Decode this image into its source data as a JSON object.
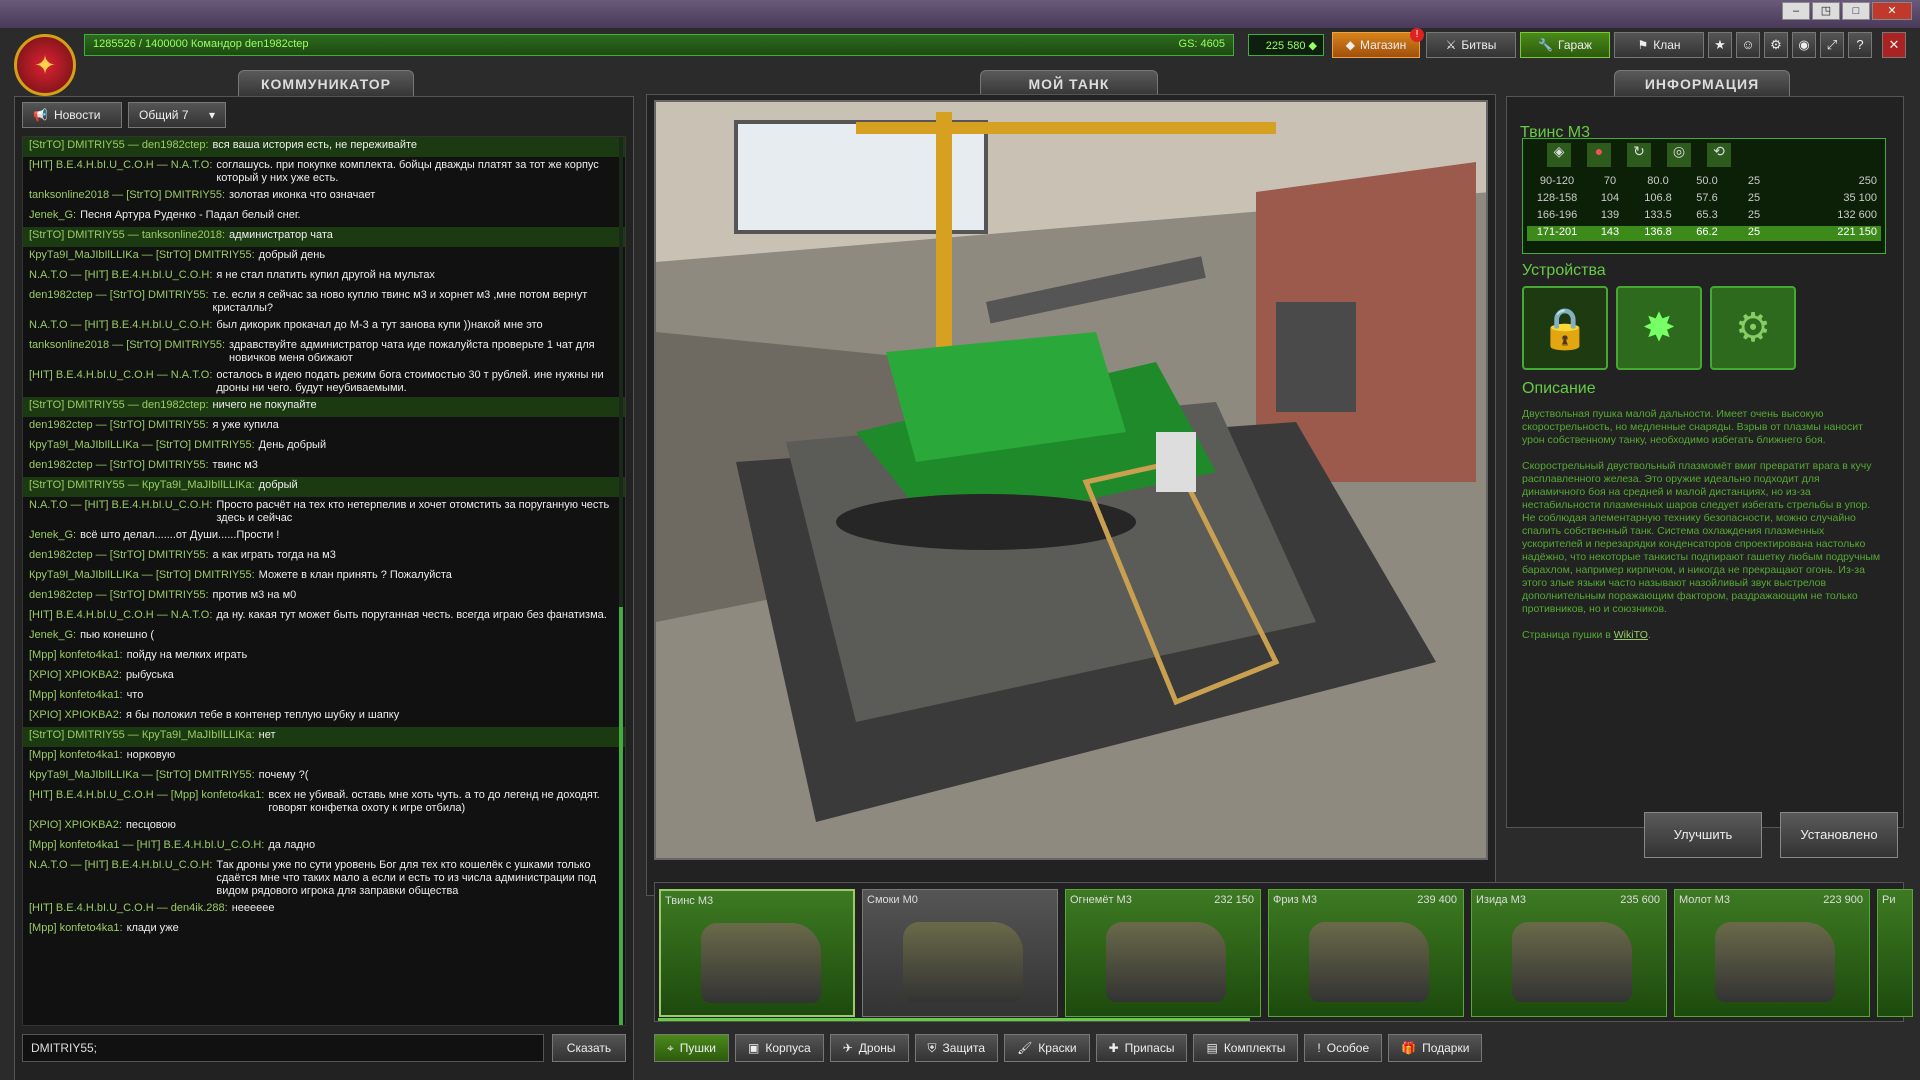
{
  "window": {
    "min": "–",
    "max": "□",
    "restore": "◳",
    "close": "✕"
  },
  "topbar": {
    "rank_progress": "1285526 / 1400000",
    "player": "Командор den1982ctep",
    "gs": "GS: 4605",
    "crystals": "225 580"
  },
  "nav": {
    "shop": "Магазин",
    "shop_badge": "!",
    "battles": "Битвы",
    "garage": "Гараж",
    "clan": "Клан"
  },
  "panels": {
    "comm": "КОММУНИКАТОР",
    "tank": "МОЙ ТАНК",
    "info": "ИНФОРМАЦИЯ"
  },
  "comm": {
    "news": "Новости",
    "channel": "Общий 7",
    "input_value": "DMITRIY55;",
    "say": "Сказать"
  },
  "chat": [
    {
      "who": "[StrTO] DMITRIY55 — den1982ctep:",
      "msg": "вся ваша история есть, не переживайте",
      "hl": true
    },
    {
      "who": "[HIT] В.Е.4.Н.bI.U_C.O.H — N.A.T.O:",
      "msg": "соглашусь. при покупке комплекта. бойцы дважды платят за тот же корпус который у них уже есть.",
      "hl": false
    },
    {
      "who": "tanksonline2018 — [StrTO] DMITRIY55:",
      "msg": "золотая иконка что означает",
      "hl": false
    },
    {
      "who": "Jenek_G:",
      "msg": "Песня Артура Руденко - Падал белый снег.",
      "hl": false
    },
    {
      "who": "[StrTO] DMITRIY55 — tanksonline2018:",
      "msg": "администратор чата",
      "hl": true
    },
    {
      "who": "КруТа9I_MaJIbIlLLIKa — [StrTO] DMITRIY55:",
      "msg": "добрый день",
      "hl": false
    },
    {
      "who": "N.A.T.O — [HIT] В.Е.4.Н.bI.U_C.O.H:",
      "msg": "я не стал платить купил другой на мультах",
      "hl": false
    },
    {
      "who": "den1982ctep — [StrTO] DMITRIY55:",
      "msg": "т.е. если я сейчас за ново куплю твинс м3 и хорнет м3 ,мне потом вернут кристаллы?",
      "hl": false
    },
    {
      "who": "N.A.T.O — [HIT] В.Е.4.Н.bI.U_C.O.H:",
      "msg": "был дикорик прокачал до М-3 а тут занова купи ))накой мне это",
      "hl": false
    },
    {
      "who": "tanksonline2018 — [StrTO] DMITRIY55:",
      "msg": "здравствуйте администратор чата иде пожалуйста проверьте 1 чат для новичков меня обижают",
      "hl": false
    },
    {
      "who": "[HIT] В.Е.4.Н.bI.U_C.O.H — N.A.T.O:",
      "msg": "осталось в идею подать режим бога стоимостью 30 т рублей. ине нужны ни дроны ни чего. будут неубиваемыми.",
      "hl": false
    },
    {
      "who": "[StrTO] DMITRIY55 — den1982ctep:",
      "msg": "ничего не покупайте",
      "hl": true
    },
    {
      "who": "den1982ctep — [StrTO] DMITRIY55:",
      "msg": "я уже купила",
      "hl": false
    },
    {
      "who": "КруТа9I_MaJIbIlLLIKa — [StrTO] DMITRIY55:",
      "msg": "День добрый",
      "hl": false
    },
    {
      "who": "den1982ctep — [StrTO] DMITRIY55:",
      "msg": "твинс м3",
      "hl": false
    },
    {
      "who": "[StrTO] DMITRIY55 — КруТа9I_MaJIbIlLLIKa:",
      "msg": "добрый",
      "hl": true
    },
    {
      "who": "N.A.T.O — [HIT] В.Е.4.Н.bI.U_C.O.H:",
      "msg": "Просто расчёт на тех кто нетерпелив и хочет отомстить за поруганную честь здесь и сейчас",
      "hl": false
    },
    {
      "who": "Jenek_G:",
      "msg": "всё што делал.......от Души......Прости !",
      "hl": false
    },
    {
      "who": "den1982ctep — [StrTO] DMITRIY55:",
      "msg": "а как играть тогда на м3",
      "hl": false
    },
    {
      "who": "КруТа9I_MaJIbIlLLIKa — [StrTO] DMITRIY55:",
      "msg": "Можете в клан принять ? Пожалуйста",
      "hl": false
    },
    {
      "who": "den1982ctep — [StrTO] DMITRIY55:",
      "msg": "против м3 на м0",
      "hl": false
    },
    {
      "who": "[HIT] В.Е.4.Н.bI.U_C.O.H — N.A.T.O:",
      "msg": "да ну. какая тут может быть поруганная честь. всегда играю без фанатизма.",
      "hl": false
    },
    {
      "who": "Jenek_G:",
      "msg": "пью конешно (",
      "hl": false
    },
    {
      "who": "[Mpp] konfeto4ka1:",
      "msg": "пойду на мелких играть",
      "hl": false
    },
    {
      "who": "[XPIO] XPIOKBA2:",
      "msg": "рыбуська",
      "hl": false
    },
    {
      "who": "[Mpp] konfeto4ka1:",
      "msg": "что",
      "hl": false
    },
    {
      "who": "[XPIO] XPIOKBA2:",
      "msg": "я бы положил тебе в контенер теплую шубку и шапку",
      "hl": false
    },
    {
      "who": "[StrTO] DMITRIY55 — КруТа9I_MaJIbIlLLIKa:",
      "msg": "нет",
      "hl": true
    },
    {
      "who": "[Mpp] konfeto4ka1:",
      "msg": "норковую",
      "hl": false
    },
    {
      "who": "КруТа9I_MaJIbIlLLIKa — [StrTO] DMITRIY55:",
      "msg": "почему ?(",
      "hl": false
    },
    {
      "who": "[HIT] В.Е.4.Н.bI.U_C.O.H — [Mpp] konfeto4ka1:",
      "msg": "всех не убивай. оставь мне хоть чуть. а то до легенд не доходят. говорят конфетка охоту к игре отбила)",
      "hl": false
    },
    {
      "who": "[XPIO] XPIOKBA2:",
      "msg": "песцовою",
      "hl": false
    },
    {
      "who": "[Mpp] konfeto4ka1 — [HIT] В.Е.4.Н.bI.U_C.O.H:",
      "msg": "да ладно",
      "hl": false
    },
    {
      "who": "N.A.T.O — [HIT] В.Е.4.Н.bI.U_C.O.H:",
      "msg": "Так дроны уже по сути уровень Бог для тех кто кошелёк с ушками только сдаётся мне что таких мало а если и есть то из числа администрации под видом рядового игрока для заправки общества",
      "hl": false
    },
    {
      "who": "[HIT] В.Е.4.Н.bI.U_C.O.H — den4ik.288:",
      "msg": "нееееее",
      "hl": false
    },
    {
      "who": "[Mpp] konfeto4ka1:",
      "msg": "клади уже",
      "hl": false
    }
  ],
  "info": {
    "title": "Твинс М3",
    "stats": [
      {
        "a": "90-120",
        "b": "70",
        "c": "80.0",
        "d": "50.0",
        "e": "25",
        "f": "250",
        "cur": false
      },
      {
        "a": "128-158",
        "b": "104",
        "c": "106.8",
        "d": "57.6",
        "e": "25",
        "f": "35 100",
        "cur": false
      },
      {
        "a": "166-196",
        "b": "139",
        "c": "133.5",
        "d": "65.3",
        "e": "25",
        "f": "132 600",
        "cur": false
      },
      {
        "a": "171-201",
        "b": "143",
        "c": "136.8",
        "d": "66.2",
        "e": "25",
        "f": "221 150",
        "cur": true
      }
    ],
    "devices_title": "Устройства",
    "desc_title": "Описание",
    "desc1": "Двуствольная пушка малой дальности. Имеет очень высокую скорострельность, но медленные снаряды. Взрыв от плазмы наносит урон собственному танку, необходимо избегать ближнего боя.",
    "desc2": "Скорострельный двуствольный плазмомёт вмиг превратит врага в кучу расплавленного железа. Это оружие идеально подходит для динамичного боя на средней и малой дистанциях, но из-за нестабильности плазменных шаров следует избегать стрельбы в упор. Не соблюдая элементарную технику безопасности, можно случайно спалить собственный танк. Система охлаждения плазменных ускорителей и перезарядки конденсаторов спроектирована настолько надёжно, что некоторые танкисты подпирают гашетку любым подручным барахлом, например кирпичом, и никогда не прекращают огонь. Из-за этого злые языки часто называют назойливый звук выстрелов дополнительным поражающим фактором, раздражающим не только противников, но и союзников.",
    "desc3": "Страница пушки в",
    "wiki": "WikiTO",
    "upgrade": "Улучшить",
    "installed": "Установлено"
  },
  "items": [
    {
      "name": "Твинс М3",
      "price": ""
    },
    {
      "name": "Смоки М0",
      "price": ""
    },
    {
      "name": "Огнемёт М3",
      "price": "232 150"
    },
    {
      "name": "Фриз М3",
      "price": "239 400"
    },
    {
      "name": "Изида М3",
      "price": "235 600"
    },
    {
      "name": "Молот М3",
      "price": "223 900"
    },
    {
      "name": "Ри",
      "price": ""
    }
  ],
  "tabs": [
    "Пушки",
    "Корпуса",
    "Дроны",
    "Защита",
    "Краски",
    "Припасы",
    "Комплекты",
    "Особое",
    "Подарки"
  ]
}
